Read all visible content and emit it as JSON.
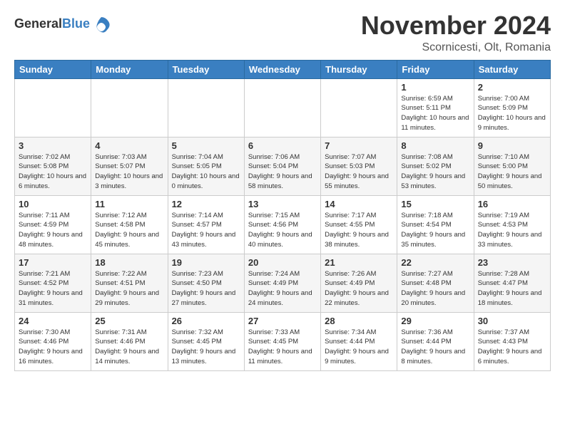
{
  "header": {
    "logo_general": "General",
    "logo_blue": "Blue",
    "month": "November 2024",
    "location": "Scornicesti, Olt, Romania"
  },
  "columns": [
    "Sunday",
    "Monday",
    "Tuesday",
    "Wednesday",
    "Thursday",
    "Friday",
    "Saturday"
  ],
  "weeks": [
    [
      {
        "day": "",
        "info": ""
      },
      {
        "day": "",
        "info": ""
      },
      {
        "day": "",
        "info": ""
      },
      {
        "day": "",
        "info": ""
      },
      {
        "day": "",
        "info": ""
      },
      {
        "day": "1",
        "info": "Sunrise: 6:59 AM\nSunset: 5:11 PM\nDaylight: 10 hours and 11 minutes."
      },
      {
        "day": "2",
        "info": "Sunrise: 7:00 AM\nSunset: 5:09 PM\nDaylight: 10 hours and 9 minutes."
      }
    ],
    [
      {
        "day": "3",
        "info": "Sunrise: 7:02 AM\nSunset: 5:08 PM\nDaylight: 10 hours and 6 minutes."
      },
      {
        "day": "4",
        "info": "Sunrise: 7:03 AM\nSunset: 5:07 PM\nDaylight: 10 hours and 3 minutes."
      },
      {
        "day": "5",
        "info": "Sunrise: 7:04 AM\nSunset: 5:05 PM\nDaylight: 10 hours and 0 minutes."
      },
      {
        "day": "6",
        "info": "Sunrise: 7:06 AM\nSunset: 5:04 PM\nDaylight: 9 hours and 58 minutes."
      },
      {
        "day": "7",
        "info": "Sunrise: 7:07 AM\nSunset: 5:03 PM\nDaylight: 9 hours and 55 minutes."
      },
      {
        "day": "8",
        "info": "Sunrise: 7:08 AM\nSunset: 5:02 PM\nDaylight: 9 hours and 53 minutes."
      },
      {
        "day": "9",
        "info": "Sunrise: 7:10 AM\nSunset: 5:00 PM\nDaylight: 9 hours and 50 minutes."
      }
    ],
    [
      {
        "day": "10",
        "info": "Sunrise: 7:11 AM\nSunset: 4:59 PM\nDaylight: 9 hours and 48 minutes."
      },
      {
        "day": "11",
        "info": "Sunrise: 7:12 AM\nSunset: 4:58 PM\nDaylight: 9 hours and 45 minutes."
      },
      {
        "day": "12",
        "info": "Sunrise: 7:14 AM\nSunset: 4:57 PM\nDaylight: 9 hours and 43 minutes."
      },
      {
        "day": "13",
        "info": "Sunrise: 7:15 AM\nSunset: 4:56 PM\nDaylight: 9 hours and 40 minutes."
      },
      {
        "day": "14",
        "info": "Sunrise: 7:17 AM\nSunset: 4:55 PM\nDaylight: 9 hours and 38 minutes."
      },
      {
        "day": "15",
        "info": "Sunrise: 7:18 AM\nSunset: 4:54 PM\nDaylight: 9 hours and 35 minutes."
      },
      {
        "day": "16",
        "info": "Sunrise: 7:19 AM\nSunset: 4:53 PM\nDaylight: 9 hours and 33 minutes."
      }
    ],
    [
      {
        "day": "17",
        "info": "Sunrise: 7:21 AM\nSunset: 4:52 PM\nDaylight: 9 hours and 31 minutes."
      },
      {
        "day": "18",
        "info": "Sunrise: 7:22 AM\nSunset: 4:51 PM\nDaylight: 9 hours and 29 minutes."
      },
      {
        "day": "19",
        "info": "Sunrise: 7:23 AM\nSunset: 4:50 PM\nDaylight: 9 hours and 27 minutes."
      },
      {
        "day": "20",
        "info": "Sunrise: 7:24 AM\nSunset: 4:49 PM\nDaylight: 9 hours and 24 minutes."
      },
      {
        "day": "21",
        "info": "Sunrise: 7:26 AM\nSunset: 4:49 PM\nDaylight: 9 hours and 22 minutes."
      },
      {
        "day": "22",
        "info": "Sunrise: 7:27 AM\nSunset: 4:48 PM\nDaylight: 9 hours and 20 minutes."
      },
      {
        "day": "23",
        "info": "Sunrise: 7:28 AM\nSunset: 4:47 PM\nDaylight: 9 hours and 18 minutes."
      }
    ],
    [
      {
        "day": "24",
        "info": "Sunrise: 7:30 AM\nSunset: 4:46 PM\nDaylight: 9 hours and 16 minutes."
      },
      {
        "day": "25",
        "info": "Sunrise: 7:31 AM\nSunset: 4:46 PM\nDaylight: 9 hours and 14 minutes."
      },
      {
        "day": "26",
        "info": "Sunrise: 7:32 AM\nSunset: 4:45 PM\nDaylight: 9 hours and 13 minutes."
      },
      {
        "day": "27",
        "info": "Sunrise: 7:33 AM\nSunset: 4:45 PM\nDaylight: 9 hours and 11 minutes."
      },
      {
        "day": "28",
        "info": "Sunrise: 7:34 AM\nSunset: 4:44 PM\nDaylight: 9 hours and 9 minutes."
      },
      {
        "day": "29",
        "info": "Sunrise: 7:36 AM\nSunset: 4:44 PM\nDaylight: 9 hours and 8 minutes."
      },
      {
        "day": "30",
        "info": "Sunrise: 7:37 AM\nSunset: 4:43 PM\nDaylight: 9 hours and 6 minutes."
      }
    ]
  ]
}
